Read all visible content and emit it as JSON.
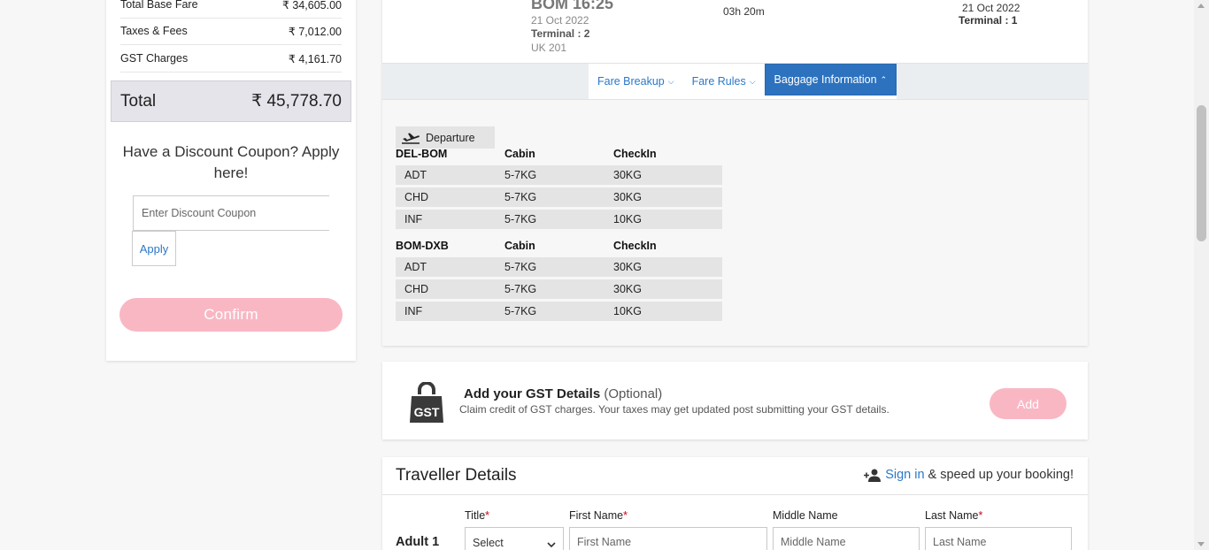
{
  "fare_summary": {
    "rows": [
      {
        "label": "Total Base Fare",
        "value": "₹ 34,605.00"
      },
      {
        "label": "Taxes & Fees",
        "value": "₹ 7,012.00"
      },
      {
        "label": "GST Charges",
        "value": "₹ 4,161.70"
      }
    ],
    "total_label": "Total",
    "total_value": "₹ 45,778.70"
  },
  "coupon": {
    "heading": "Have a Discount Coupon? Apply here!",
    "placeholder": "Enter Discount Coupon",
    "apply_label": "Apply"
  },
  "confirm_label": "Confirm",
  "flight": {
    "departure_time": "BOM 16:25",
    "departure_date": "21 Oct 2022",
    "departure_terminal": "Terminal : 2",
    "flight_code": "UK 201",
    "duration": "03h 20m",
    "arrival_date": "21 Oct 2022",
    "arrival_terminal": "Terminal : 1"
  },
  "tabs": [
    {
      "label": "Fare Breakup",
      "active": false
    },
    {
      "label": "Fare Rules",
      "active": false
    },
    {
      "label": "Baggage Information",
      "active": true
    }
  ],
  "baggage": {
    "section_label": "Departure",
    "columns": {
      "cabin": "Cabin",
      "checkin": "CheckIn"
    },
    "sectors": [
      {
        "route": "DEL-BOM",
        "rows": [
          {
            "pax": "ADT",
            "cabin": "5-7KG",
            "checkin": "30KG"
          },
          {
            "pax": "CHD",
            "cabin": "5-7KG",
            "checkin": "30KG"
          },
          {
            "pax": "INF",
            "cabin": "5-7KG",
            "checkin": "10KG"
          }
        ]
      },
      {
        "route": "BOM-DXB",
        "rows": [
          {
            "pax": "ADT",
            "cabin": "5-7KG",
            "checkin": "30KG"
          },
          {
            "pax": "CHD",
            "cabin": "5-7KG",
            "checkin": "30KG"
          },
          {
            "pax": "INF",
            "cabin": "5-7KG",
            "checkin": "10KG"
          }
        ]
      }
    ]
  },
  "gst": {
    "icon_text": "GST",
    "title": "Add your GST Details",
    "optional": "(Optional)",
    "subtitle": "Claim credit of GST charges. Your taxes may get updated post submitting your GST details.",
    "add_label": "Add"
  },
  "traveller": {
    "title": "Traveller Details",
    "signin_link": "Sign in",
    "signin_suffix": "& speed up your booking!",
    "adult_label": "Adult 1",
    "fields": {
      "title_label": "Title",
      "title_value": "Select",
      "first_label": "First Name",
      "first_placeholder": "First Name",
      "middle_label": "Middle Name",
      "middle_placeholder": "Middle Name",
      "last_label": "Last Name",
      "last_placeholder": "Last Name",
      "required_mark": "*"
    }
  },
  "colors": {
    "accent_blue": "#2c72bf",
    "link_blue": "#2a78c9",
    "pink_button": "#f9b7c4",
    "required_red": "#d0021b"
  }
}
